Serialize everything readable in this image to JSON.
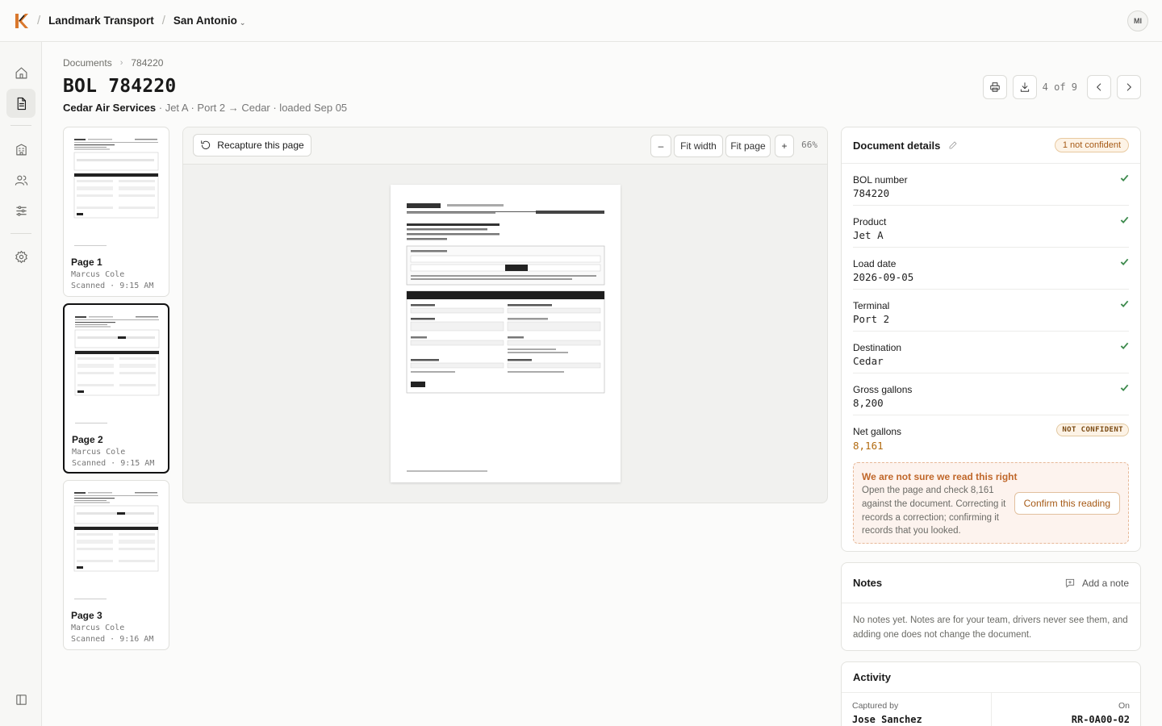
{
  "topbar": {
    "org": "Landmark Transport",
    "location": "San Antonio",
    "avatar_initials": "MI"
  },
  "breadcrumb": [
    "Documents",
    "784220"
  ],
  "page": {
    "title": "BOL 784220",
    "customer": "Cedar Air Services",
    "meta": " · Jet A · Port 2 → Cedar · loaded Sep 05",
    "pager": "4 of 9"
  },
  "thumbnails": [
    {
      "label": "Page 1",
      "by": "Marcus Cole",
      "time": "Scanned · 9:15 AM",
      "selected": false
    },
    {
      "label": "Page 2",
      "by": "Marcus Cole",
      "time": "Scanned · 9:15 AM",
      "selected": true
    },
    {
      "label": "Page 3",
      "by": "Marcus Cole",
      "time": "Scanned · 9:16 AM",
      "selected": false
    }
  ],
  "viewer": {
    "recapture_label": "Recapture this page",
    "zoom_out": "–",
    "fit_width": "Fit width",
    "fit_page": "Fit page",
    "zoom_in": "+",
    "zoom_pct": "66%"
  },
  "details": {
    "title": "Document details",
    "badge": "1 not confident",
    "fields": [
      {
        "label": "BOL number",
        "value": "784220",
        "confident": true
      },
      {
        "label": "Product",
        "value": "Jet A",
        "confident": true
      },
      {
        "label": "Load date",
        "value": "2026-09-05",
        "confident": true
      },
      {
        "label": "Terminal",
        "value": "Port 2",
        "confident": true
      },
      {
        "label": "Destination",
        "value": "Cedar",
        "confident": true
      },
      {
        "label": "Gross gallons",
        "value": "8,200",
        "confident": true
      },
      {
        "label": "Net gallons",
        "value": "8,161",
        "confident": false
      }
    ],
    "not_confident_badge": "NOT CONFIDENT",
    "alert_title": "We are not sure we read this right",
    "alert_body": "Open the page and check 8,161 against the document. Correcting it records a correction; confirming it records that you looked.",
    "confirm_label": "Confirm this reading"
  },
  "notes": {
    "title": "Notes",
    "add_label": "Add a note",
    "empty_text": "No notes yet. Notes are for your team, drivers never see them, and adding one does not change the document."
  },
  "activity": {
    "title": "Activity",
    "captured_by_label": "Captured by",
    "captured_by": "Jose Sanchez",
    "on_label": "On",
    "on_value": "RR-0A00-02"
  },
  "colors": {
    "accent_warning": "#c0672a",
    "confident_check": "#3d8a4d",
    "logo_orange": "#d9782d"
  }
}
